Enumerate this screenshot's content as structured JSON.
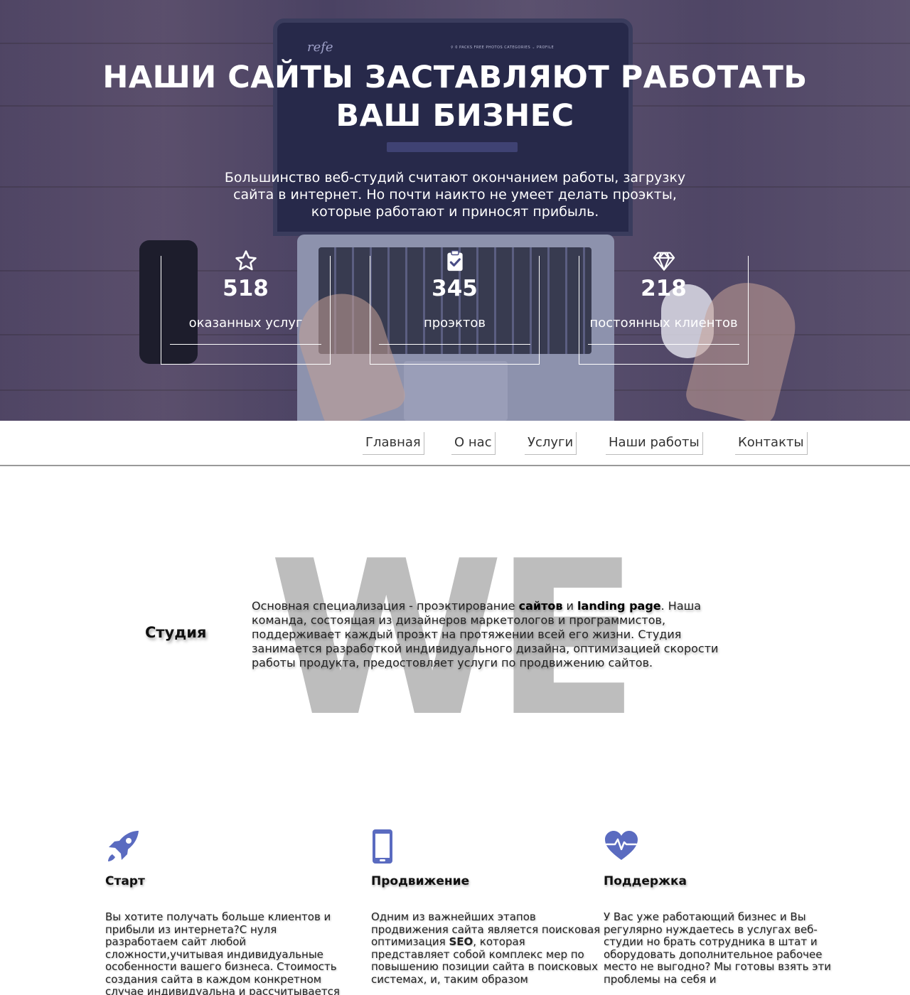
{
  "hero": {
    "title_line1": "НАШИ САЙТЫ ЗАСТАВЛЯЮТ РАБОТАТЬ",
    "title_line2": "ВАШ БИЗНЕС",
    "subtitle_line1": "Большинство веб-студий считают окончанием работы, загрузку",
    "subtitle_line2": "сайта в интернет. Но почти наикто не умеет делать проэкты,",
    "subtitle_line3": "которые работают и приносят прибыль.",
    "screen_logo": "refe",
    "screen_nav": "⚲ 0      PACKS      FREE PHOTOS      CATEGORIES ⌄      PROFILE",
    "overlay_color": "#3e4282"
  },
  "stats": [
    {
      "icon": "star-icon",
      "number": "518",
      "label": "оказанных услуг"
    },
    {
      "icon": "clipboard-check-icon",
      "number": "345",
      "label": "проэктов"
    },
    {
      "icon": "diamond-icon",
      "number": "218",
      "label": "постоянных клиентов"
    }
  ],
  "nav": {
    "items": [
      "Главная",
      "О нас",
      "Услуги",
      "Наши работы",
      "Контакты"
    ]
  },
  "about": {
    "watermark": "WE",
    "title": "Студия",
    "text_part1": "Основная специализация - проэктирование ",
    "text_bold1": "сайтов",
    "text_part2": " и ",
    "text_bold2": "landing page",
    "text_part3": ". Наша команда, состоящая из дизайнеров маркетологов и программистов, поддерживает каждый проэкт на протяжении всей его жизни. Студия занимается разработкой индивидуального дизайна, оптимизацией скорости работы продукта, предостовляет услуги по продвижению сайтов."
  },
  "services": [
    {
      "icon": "rocket-icon",
      "title": "Старт",
      "text": "Вы хотите получать больше клиентов и прибыли из интернета?С нуля разработаем сайт любой сложности,учитывая индивидуальные особенности вашего бизнеса. Стоимость создания сайта в каждом конкретном случае индивидуальна и рассчитывается"
    },
    {
      "icon": "smartphone-icon",
      "title": "Продвижение",
      "text_part1": "Одним из важнейших этапов продвижения сайта является поисковая оптимизация ",
      "text_bold": "SEO",
      "text_part2": ", которая представляет собой комплекс мер по повышению позиции сайта в поисковых системах, и, таким образом"
    },
    {
      "icon": "heart-pulse-icon",
      "title": "Поддержка",
      "text": "У Вас уже работающий бизнес и Вы регулярно нуждаетесь в услугах веб-студии но брать сотрудника в штат и оборудовать дополнительное рабочее место не выгодно? Мы готовы взять эти проблемы на себя и"
    }
  ],
  "colors": {
    "accent": "#5a6bc0",
    "nav_border": "#999999"
  }
}
